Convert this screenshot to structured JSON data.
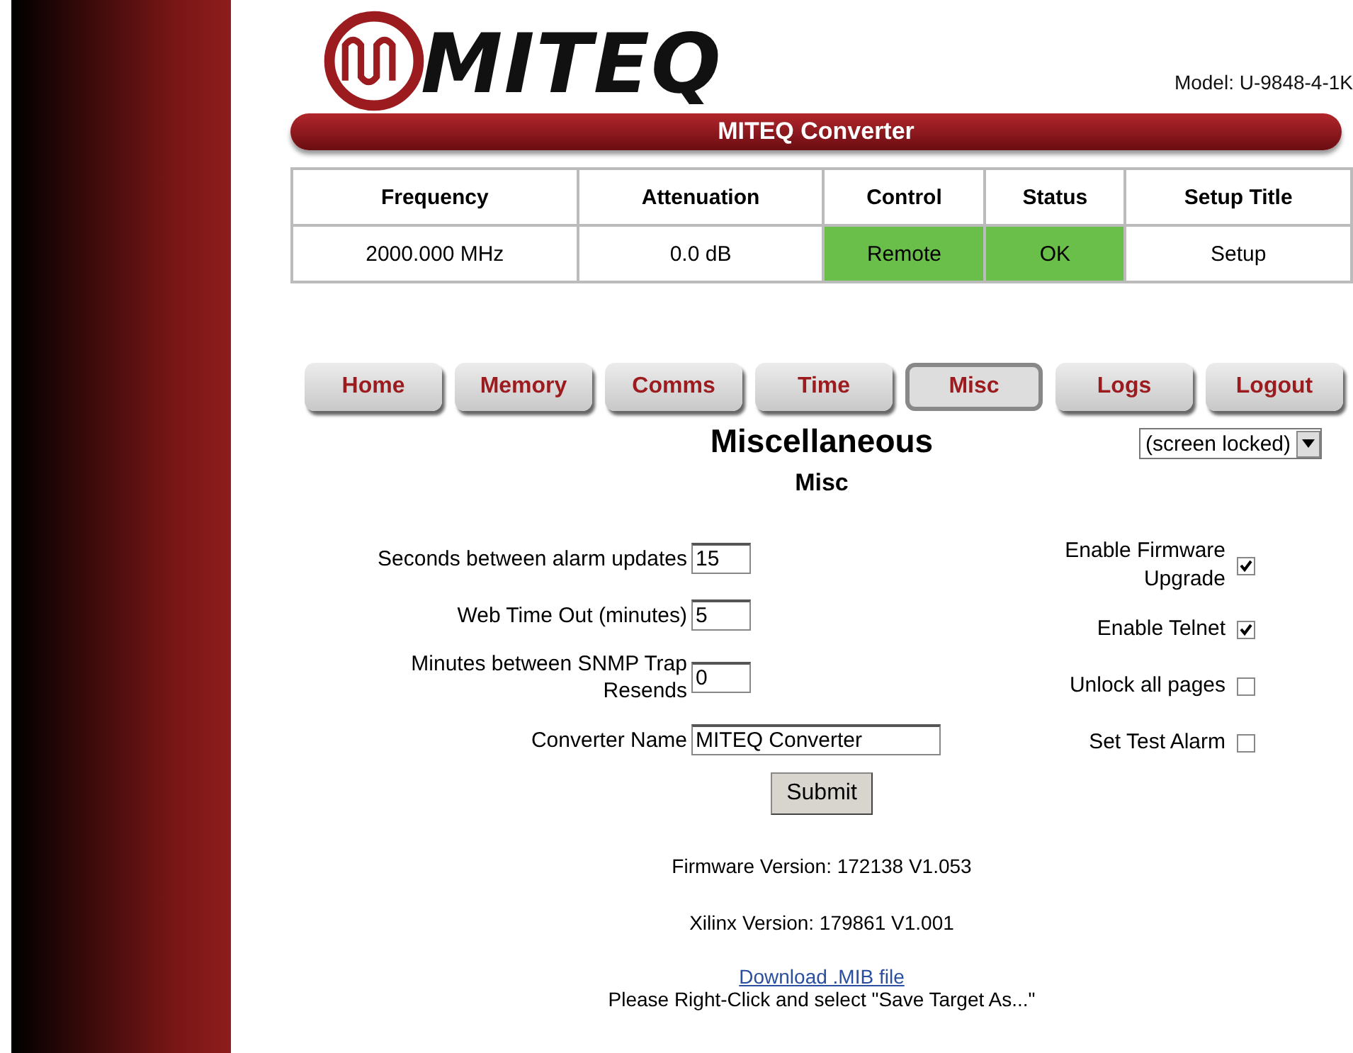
{
  "header": {
    "logo": "MITEQ",
    "model": "Model: U-9848-4-1K",
    "banner": "MITEQ Converter"
  },
  "summary_table": {
    "columns": [
      "Frequency",
      "Attenuation",
      "Control",
      "Status",
      "Setup Title"
    ],
    "cells": [
      {
        "text": "2000.000 MHz"
      },
      {
        "text": "0.0 dB"
      },
      {
        "text": "Remote",
        "color": "#6abf4b"
      },
      {
        "text": "OK",
        "color": "#6abf4b"
      },
      {
        "text": "Setup"
      }
    ]
  },
  "tabs": [
    {
      "label": "Home",
      "selected": false
    },
    {
      "label": "Memory",
      "selected": false
    },
    {
      "label": "Comms",
      "selected": false
    },
    {
      "label": "Time",
      "selected": false
    },
    {
      "label": "Misc",
      "selected": true
    },
    {
      "label": "Logs",
      "selected": false
    },
    {
      "label": "Logout",
      "selected": false
    }
  ],
  "page_title": "Miscellaneous",
  "subtitle": "Misc",
  "lock_select": "(screen locked)",
  "fields": [
    {
      "label": "Seconds between alarm updates",
      "value": "15",
      "wide": false
    },
    {
      "label": "Web Time Out (minutes)",
      "value": "5",
      "wide": false
    },
    {
      "label": "Minutes between SNMP Trap Resends",
      "value": "0",
      "wide": false
    },
    {
      "label": "Converter Name",
      "value": "MITEQ Converter",
      "wide": true
    }
  ],
  "options": [
    {
      "label": "Enable Firmware Upgrade",
      "checked": true
    },
    {
      "label": "Enable Telnet",
      "checked": true
    },
    {
      "label": "Unlock all pages",
      "checked": false
    },
    {
      "label": "Set Test Alarm",
      "checked": false
    }
  ],
  "submit": "Submit",
  "firmware": "Firmware Version: 172138 V1.053",
  "xilinx": "Xilinx Version: 179861 V1.001",
  "download_link": "Download .MIB file",
  "download_note": "Please Right-Click and select \"Save Target As...\""
}
